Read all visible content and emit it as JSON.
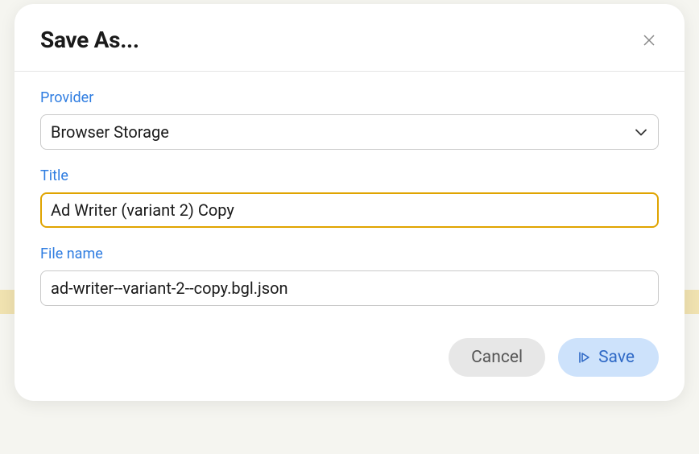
{
  "modal": {
    "title": "Save As...",
    "provider": {
      "label": "Provider",
      "value": "Browser Storage"
    },
    "titleField": {
      "label": "Title",
      "value": "Ad Writer (variant 2) Copy"
    },
    "fileName": {
      "label": "File name",
      "value": "ad-writer--variant-2--copy.bgl.json"
    },
    "buttons": {
      "cancel": "Cancel",
      "save": "Save"
    }
  },
  "colors": {
    "labelBlue": "#2f7de1",
    "focusBorder": "#e0a400",
    "saveBg": "#cde2fb",
    "saveText": "#2f69c6",
    "cancelBg": "#e7e7e7"
  }
}
